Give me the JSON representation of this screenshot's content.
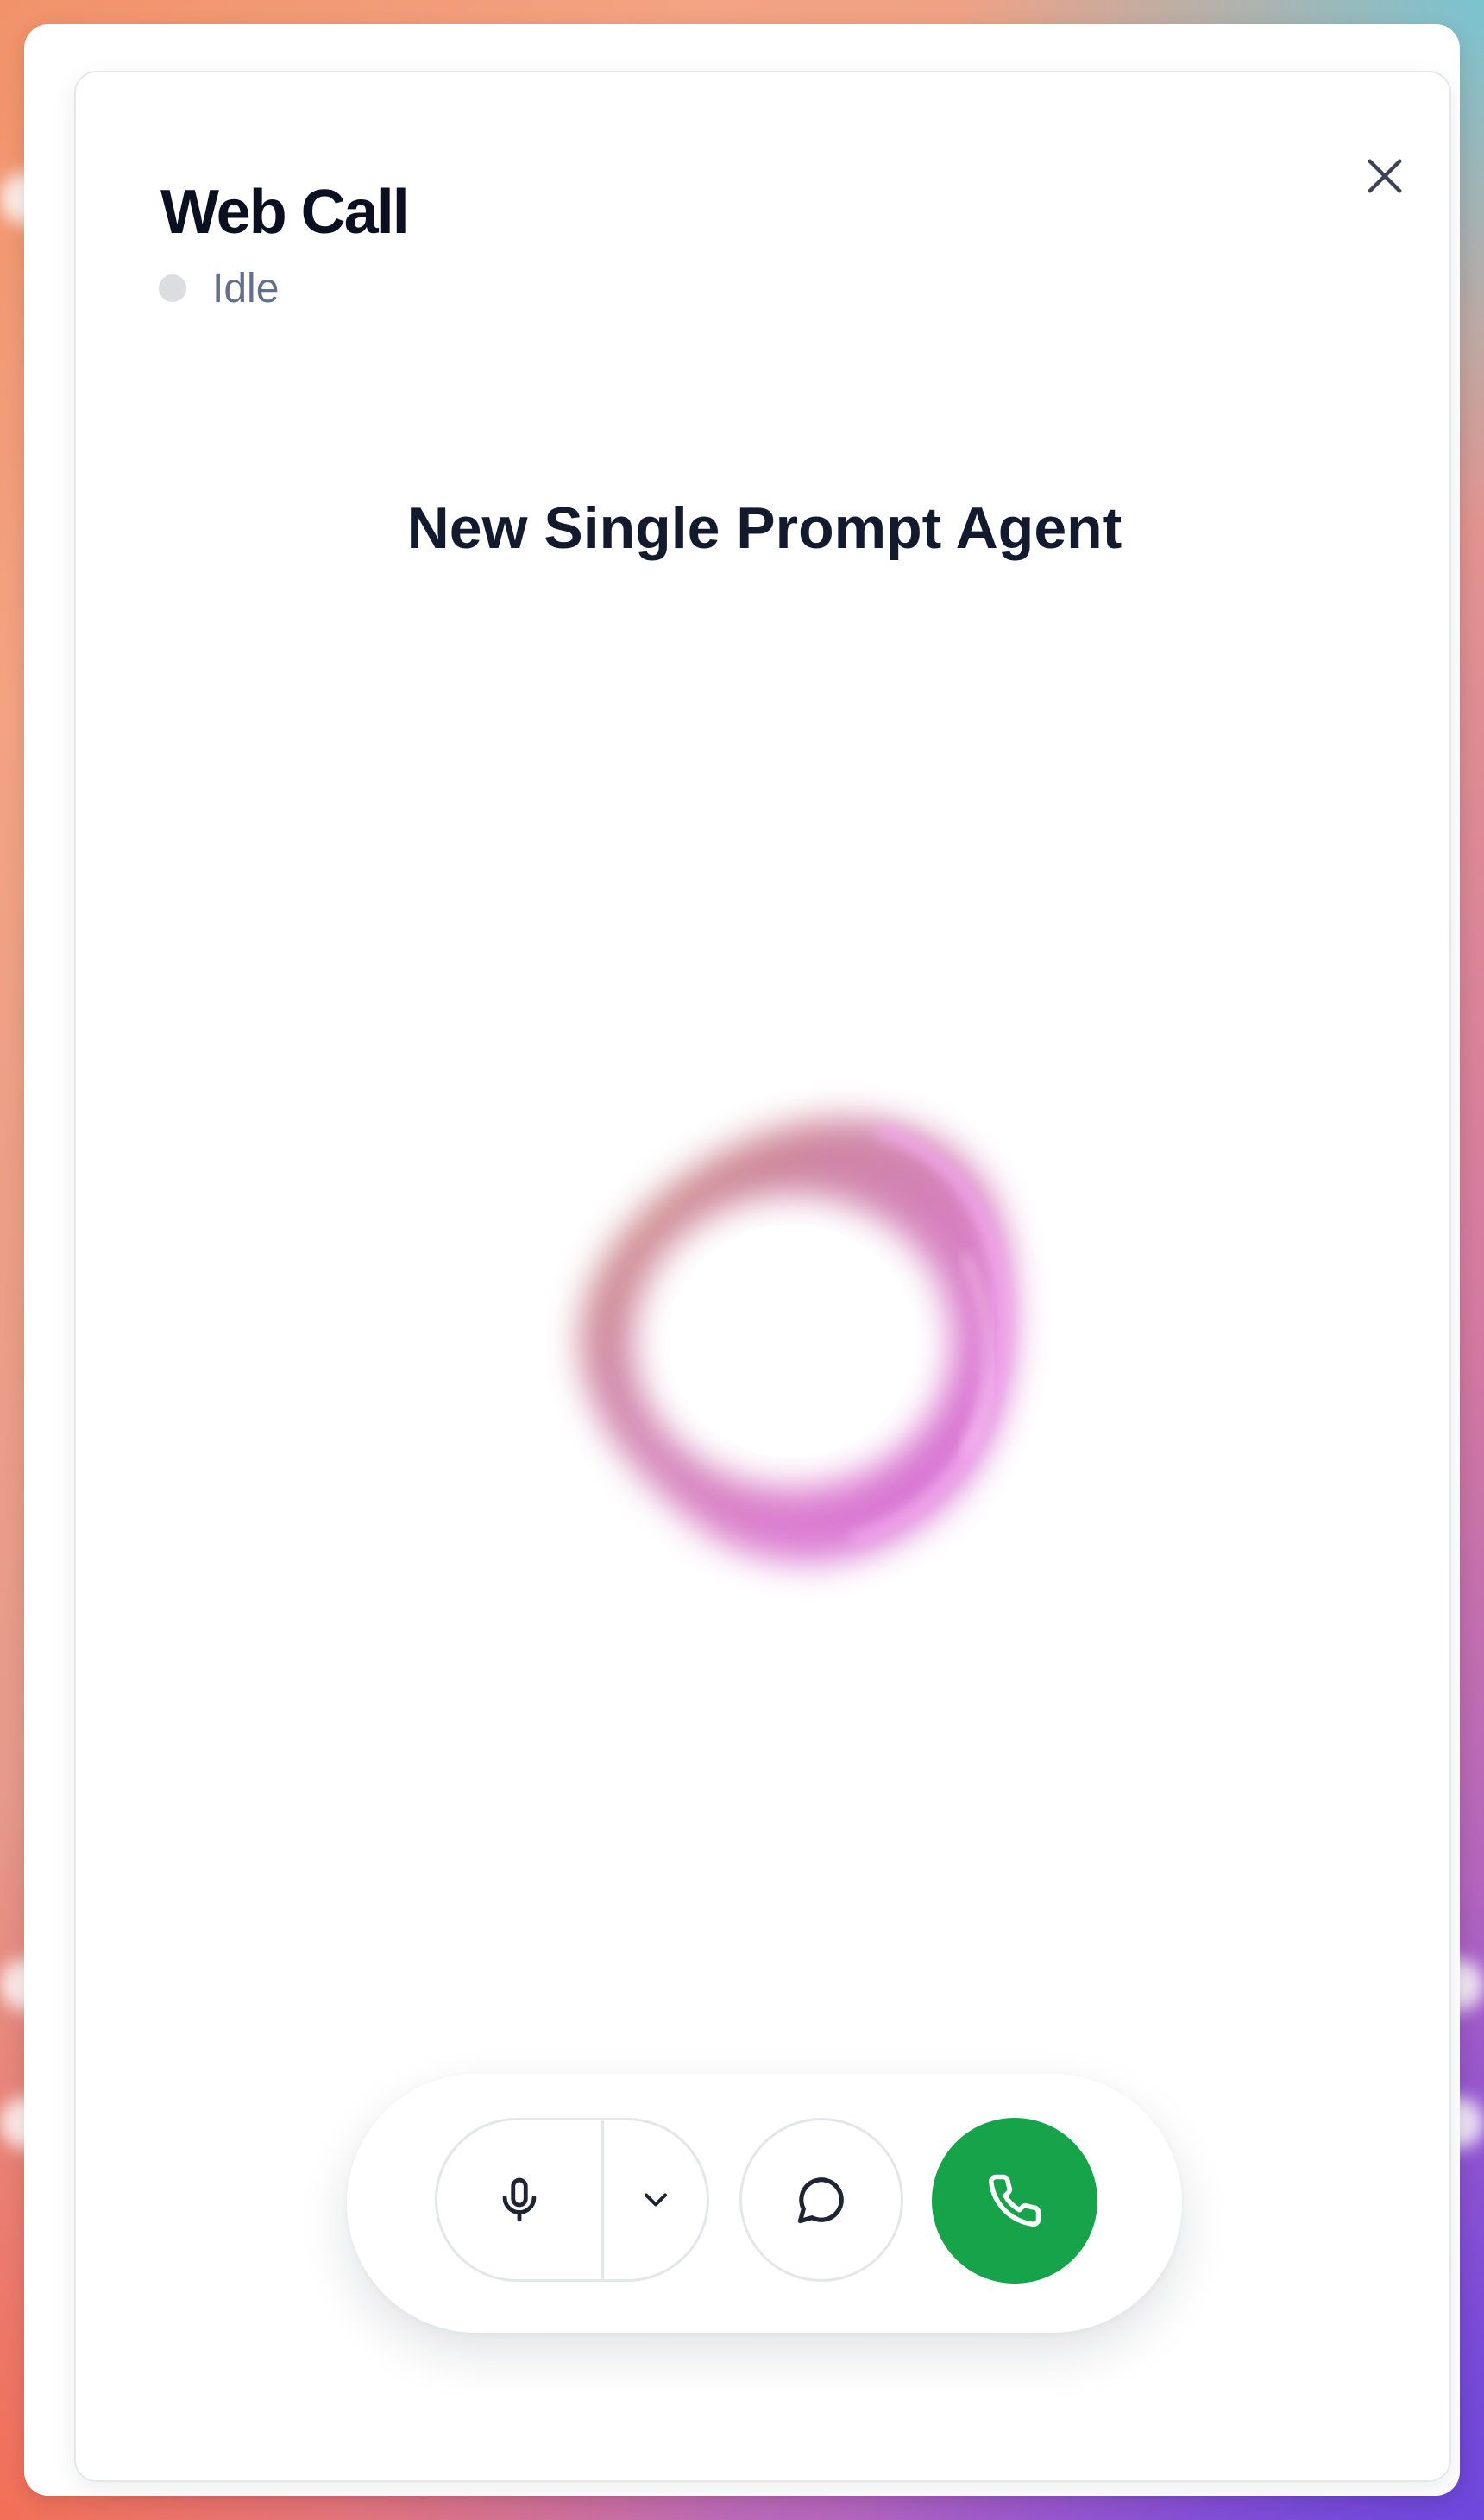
{
  "dialog": {
    "title": "Web Call",
    "status": "Idle",
    "agent_name": "New Single Prompt Agent"
  },
  "controls": {
    "mic_icon": "microphone-icon",
    "dropdown_icon": "chevron-down-icon",
    "chat_icon": "chat-bubble-icon",
    "call_icon": "phone-icon",
    "close_icon": "close-icon"
  },
  "colors": {
    "call_button": "#16a34a",
    "status_dot_idle": "#dcdde1",
    "title": "#0b1020",
    "status_text": "#64708a",
    "orb_primary": "#d15fc0",
    "orb_secondary": "#c27a6a"
  }
}
